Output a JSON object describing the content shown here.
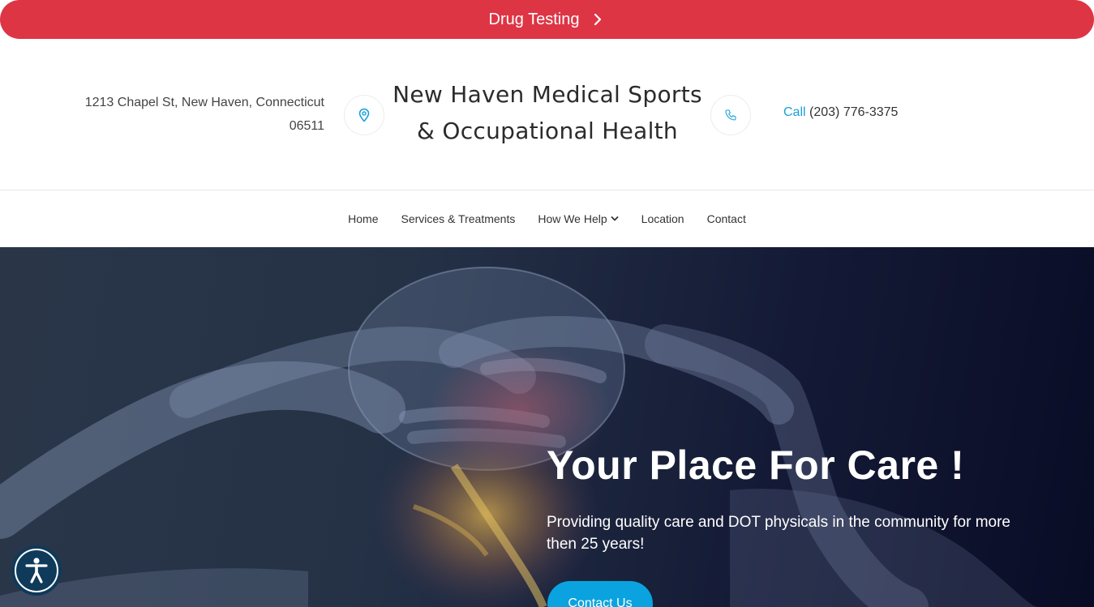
{
  "banner": {
    "label": "Drug Testing",
    "icon": "chevron-right-icon"
  },
  "header": {
    "address_line1": "1213 Chapel St, New Haven, Connecticut",
    "address_line2": "06511",
    "location_icon": "map-pin-icon",
    "title_line1": "New Haven Medical Sports",
    "title_line2": "& Occupational Health",
    "phone_icon": "phone-icon",
    "call_label": "Call",
    "phone_number": "(203) 776-3375"
  },
  "nav": {
    "items": [
      {
        "label": "Home"
      },
      {
        "label": "Services & Treatments"
      },
      {
        "label": "How We Help",
        "icon": "chevron-down-icon"
      },
      {
        "label": "Location"
      },
      {
        "label": "Contact"
      }
    ]
  },
  "hero": {
    "title": "Your Place For Care !",
    "text": "Providing quality care and DOT physicals in the community for more then 25 years!",
    "button_label": "Contact Us"
  },
  "accessibility": {
    "icon": "accessibility-icon"
  },
  "colors": {
    "banner": "#de3545",
    "accent": "#1aa0d8",
    "button": "#0aa3e0",
    "hero_dark": "#0b0f28"
  }
}
